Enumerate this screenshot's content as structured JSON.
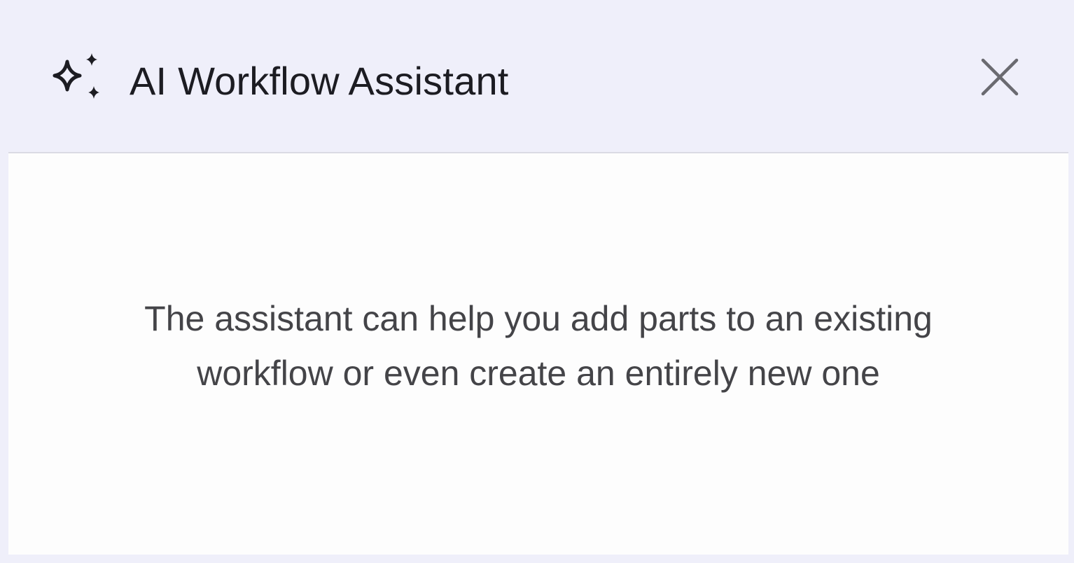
{
  "header": {
    "title": "AI Workflow Assistant",
    "icon": "sparkles-icon",
    "close_icon": "close-icon"
  },
  "content": {
    "message_line1": "The assistant can help you add parts to an existing",
    "message_line2": "workflow or even create an entirely new one"
  },
  "colors": {
    "header_background": "#efeffa",
    "content_background": "#fdfdfd",
    "title_text": "#1c1c22",
    "body_text": "#444448"
  }
}
